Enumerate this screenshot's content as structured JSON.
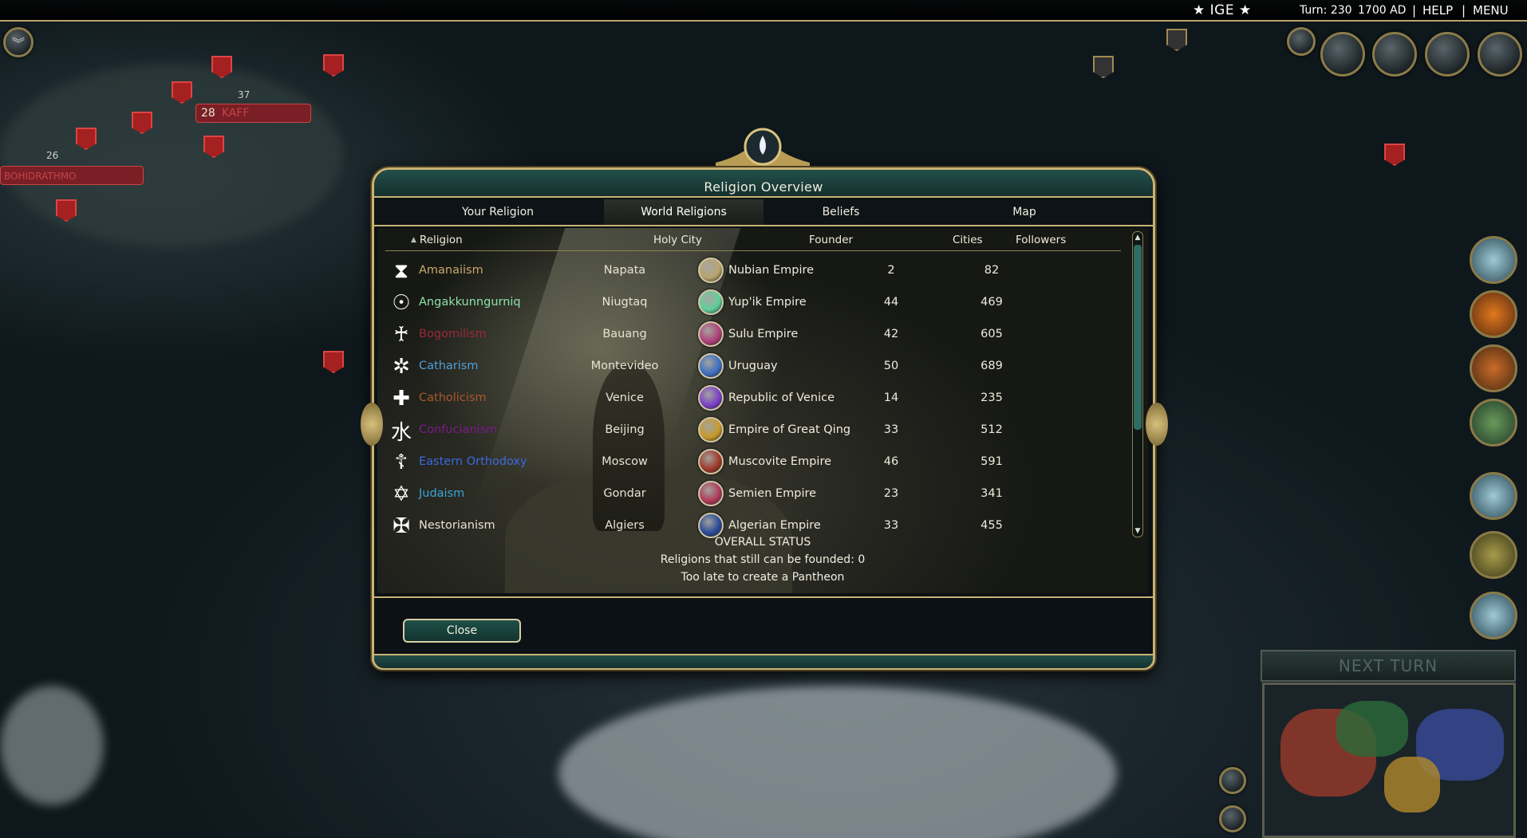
{
  "topbar": {
    "ige_label": "★ IGE ★",
    "turn": "Turn: 230",
    "year": "1700 AD",
    "separator": "|",
    "help": "HELP",
    "menu": "MENU"
  },
  "map": {
    "unit_count_a": "37",
    "unit_count_b": "26",
    "city_a_size": "28",
    "city_a_name": "KAFF",
    "city_b_name": "BOHIDRATHMO"
  },
  "next_turn": "NEXT TURN",
  "dialog": {
    "title": "Religion Overview",
    "tabs": [
      "Your Religion",
      "World Religions",
      "Beliefs",
      "Map"
    ],
    "active_tab": "World Religions",
    "columns": {
      "sort_indicator": "▲",
      "religion": "Religion",
      "holy_city": "Holy City",
      "founder": "Founder",
      "cities": "Cities",
      "followers": "Followers"
    },
    "rows": [
      {
        "religion": "Amanaiism",
        "color": "#c9a86a",
        "icon": "tabernacle-icon",
        "glyph": "⧗",
        "holy_city": "Napata",
        "founder": "Nubian Empire",
        "civ_icon": "nubian-icon",
        "civ_color": "#b8a46c",
        "cities": "2",
        "followers": "82"
      },
      {
        "religion": "Angakkunngurniq",
        "color": "#8ee0a8",
        "icon": "mask-icon",
        "glyph": "☉",
        "holy_city": "Niugtaq",
        "founder": "Yup'ik Empire",
        "civ_icon": "yupik-icon",
        "civ_color": "#5fcf9a",
        "cities": "44",
        "followers": "469"
      },
      {
        "religion": "Bogomilism",
        "color": "#9c2a3a",
        "icon": "figure-icon",
        "glyph": "♰",
        "holy_city": "Bauang",
        "founder": "Sulu Empire",
        "civ_icon": "sulu-icon",
        "civ_color": "#b0407a",
        "cities": "42",
        "followers": "605"
      },
      {
        "religion": "Catharism",
        "color": "#4f9ed8",
        "icon": "occitan-cross-icon",
        "glyph": "✲",
        "holy_city": "Montevideo",
        "founder": "Uruguay",
        "civ_icon": "uruguay-sun-icon",
        "civ_color": "#3d6fc2",
        "cities": "50",
        "followers": "689"
      },
      {
        "religion": "Catholicism",
        "color": "#a8582a",
        "icon": "cross-icon",
        "glyph": "✚",
        "holy_city": "Venice",
        "founder": "Republic of Venice",
        "civ_icon": "venice-lion-icon",
        "civ_color": "#7b3fc7",
        "cities": "14",
        "followers": "235"
      },
      {
        "religion": "Confucianism",
        "color": "#7a1a8a",
        "icon": "water-glyph-icon",
        "glyph": "水",
        "holy_city": "Beijing",
        "founder": "Empire of Great Qing",
        "civ_icon": "qing-dragon-icon",
        "civ_color": "#c99a2a",
        "cities": "33",
        "followers": "512"
      },
      {
        "religion": "Eastern Orthodoxy",
        "color": "#3a6ae0",
        "icon": "orthodox-cross-icon",
        "glyph": "☦",
        "holy_city": "Moscow",
        "founder": "Muscovite Empire",
        "civ_icon": "muscovite-eagle-icon",
        "civ_color": "#a0392a",
        "cities": "46",
        "followers": "591"
      },
      {
        "religion": "Judaism",
        "color": "#3aa6d8",
        "icon": "star-of-david-icon",
        "glyph": "✡",
        "holy_city": "Gondar",
        "founder": "Semien Empire",
        "civ_icon": "semien-icon",
        "civ_color": "#b03a5a",
        "cities": "23",
        "followers": "341"
      },
      {
        "religion": "Nestorianism",
        "color": "#e8e3d2",
        "icon": "nestorian-icon",
        "glyph": "✠",
        "holy_city": "Algiers",
        "founder": "Algerian Empire",
        "civ_icon": "algerian-icon",
        "civ_color": "#2a4a9a",
        "cities": "33",
        "followers": "455"
      }
    ],
    "overall_status": {
      "heading": "OVERALL STATUS",
      "line1": "Religions that still can be founded: 0",
      "line2": "Too late to create a Pantheon"
    },
    "close_label": "Close"
  }
}
